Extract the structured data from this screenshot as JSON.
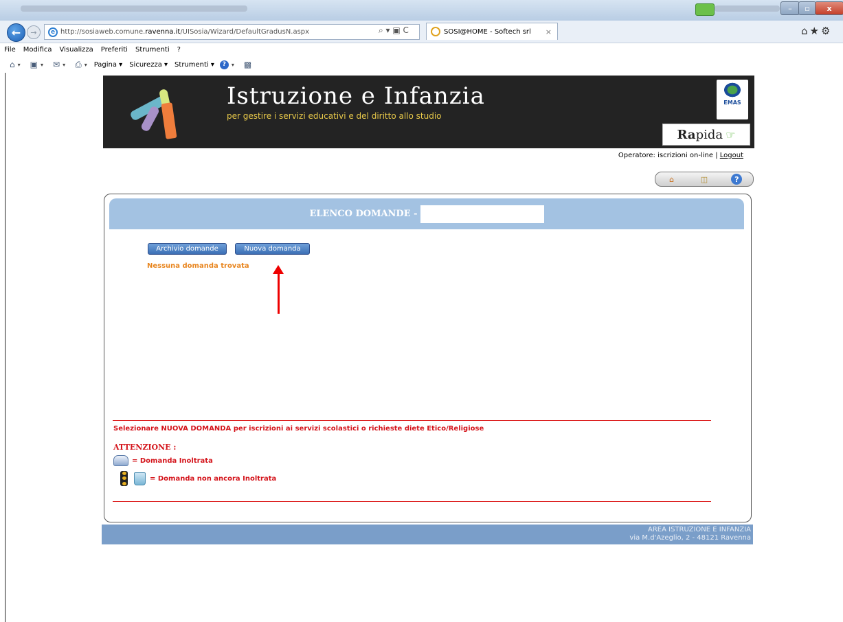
{
  "browser": {
    "address_url_prefix": "http://sosiaweb.comune.",
    "address_url_domain": "ravenna.it",
    "address_url_path": "/UISosia/Wizard/DefaultGradusN.aspx",
    "address_tools": "⌕ ▾ ▣ C",
    "tab_title": "SOSI@HOME - Softech srl",
    "tab_close": "×",
    "window_buttons": {
      "minimize": "–",
      "maximize": "▫",
      "close": "x"
    },
    "right_icons": "⌂★⚙",
    "menu": [
      "File",
      "Modifica",
      "Visualizza",
      "Preferiti",
      "Strumenti",
      "?"
    ],
    "command_bar": {
      "page": "Pagina ▾",
      "safety": "Sicurezza ▾",
      "tools": "Strumenti ▾"
    }
  },
  "header": {
    "title": "Istruzione e Infanzia",
    "subtitle": "per gestire i servizi educativi e del diritto allo studio",
    "emas_label": "EMAS",
    "rapida_bold": "Ra",
    "rapida_rest": "pida"
  },
  "operator": {
    "label": "Operatore: iscrizioni on-line | ",
    "logout": "Logout"
  },
  "panel": {
    "title": "ELENCO DOMANDE - ",
    "archive_button": "Archivio domande",
    "new_button": "Nuova domanda",
    "empty_message": "Nessuna domanda trovata",
    "instruction": "Selezionare NUOVA DOMANDA per iscrizioni ai servizi scolastici o richieste diete Etico/Religiose",
    "attention": "ATTENZIONE :",
    "legend_sent": "= Domanda Inoltrata",
    "legend_not_sent": "= Domanda non ancora Inoltrata"
  },
  "footer": {
    "line1": "AREA ISTRUZIONE E INFANZIA",
    "line2": "via M.d'Azeglio, 2 - 48121 Ravenna"
  },
  "colors": {
    "banner_bg": "#232323",
    "panel_header": "#a3c2e2",
    "alert_red": "#d4141b",
    "empty_orange": "#e8851e",
    "footer_bg": "#7a9ec9"
  }
}
